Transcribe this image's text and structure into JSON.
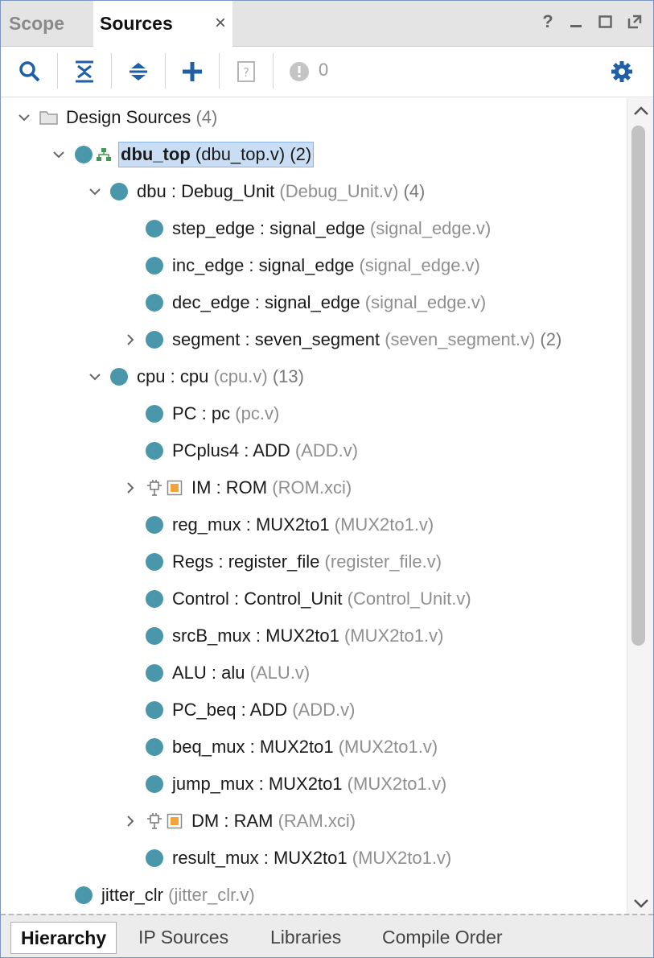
{
  "tabs": {
    "scope": "Scope",
    "sources": "Sources",
    "close_glyph": "×"
  },
  "window_controls": {
    "help": "?",
    "minimize": "_",
    "maximize": "☐",
    "float": "⧉"
  },
  "toolbar": {
    "icons": [
      "search-icon",
      "collapse-all-icon",
      "expand-all-icon",
      "add-icon",
      "unknown-file-icon",
      "error-status-icon",
      "gear-icon"
    ],
    "error_count": "0",
    "accent_color": "#1f5fa6"
  },
  "tree": {
    "root": {
      "label": "Design Sources",
      "count": "(4)"
    },
    "top": {
      "name": "dbu_top",
      "file": "(dbu_top.v)",
      "count": "(2)"
    },
    "dbu": {
      "inst": "dbu",
      "mod": "Debug_Unit",
      "file": "(Debug_Unit.v)",
      "count": "(4)"
    },
    "step_edge": {
      "inst": "step_edge",
      "mod": "signal_edge",
      "file": "(signal_edge.v)"
    },
    "inc_edge": {
      "inst": "inc_edge",
      "mod": "signal_edge",
      "file": "(signal_edge.v)"
    },
    "dec_edge": {
      "inst": "dec_edge",
      "mod": "signal_edge",
      "file": "(signal_edge.v)"
    },
    "segment": {
      "inst": "segment",
      "mod": "seven_segment",
      "file": "(seven_segment.v)",
      "count": "(2)"
    },
    "cpu": {
      "inst": "cpu",
      "mod": "cpu",
      "file": "(cpu.v)",
      "count": "(13)"
    },
    "pc": {
      "inst": "PC",
      "mod": "pc",
      "file": "(pc.v)"
    },
    "pcplus4": {
      "inst": "PCplus4",
      "mod": "ADD",
      "file": "(ADD.v)"
    },
    "im": {
      "inst": "IM",
      "mod": "ROM",
      "file": "(ROM.xci)"
    },
    "reg_mux": {
      "inst": "reg_mux",
      "mod": "MUX2to1",
      "file": "(MUX2to1.v)"
    },
    "regs": {
      "inst": "Regs",
      "mod": "register_file",
      "file": "(register_file.v)"
    },
    "control": {
      "inst": "Control",
      "mod": "Control_Unit",
      "file": "(Control_Unit.v)"
    },
    "srcb_mux": {
      "inst": "srcB_mux",
      "mod": "MUX2to1",
      "file": "(MUX2to1.v)"
    },
    "alu": {
      "inst": "ALU",
      "mod": "alu",
      "file": "(ALU.v)"
    },
    "pc_beq": {
      "inst": "PC_beq",
      "mod": "ADD",
      "file": "(ADD.v)"
    },
    "beq_mux": {
      "inst": "beq_mux",
      "mod": "MUX2to1",
      "file": "(MUX2to1.v)"
    },
    "jump_mux": {
      "inst": "jump_mux",
      "mod": "MUX2to1",
      "file": "(MUX2to1.v)"
    },
    "dm": {
      "inst": "DM",
      "mod": "RAM",
      "file": "(RAM.xci)"
    },
    "result_mux": {
      "inst": "result_mux",
      "mod": "MUX2to1",
      "file": "(MUX2to1.v)"
    },
    "jitter_clr": {
      "name": "jitter_clr",
      "file": "(jitter_clr.v)"
    },
    "sep": " : ",
    "node_color": "#4a97ab",
    "ip_color": "#f2a33a"
  },
  "bottom_tabs": {
    "hierarchy": "Hierarchy",
    "ip_sources": "IP Sources",
    "libraries": "Libraries",
    "compile_order": "Compile Order"
  }
}
